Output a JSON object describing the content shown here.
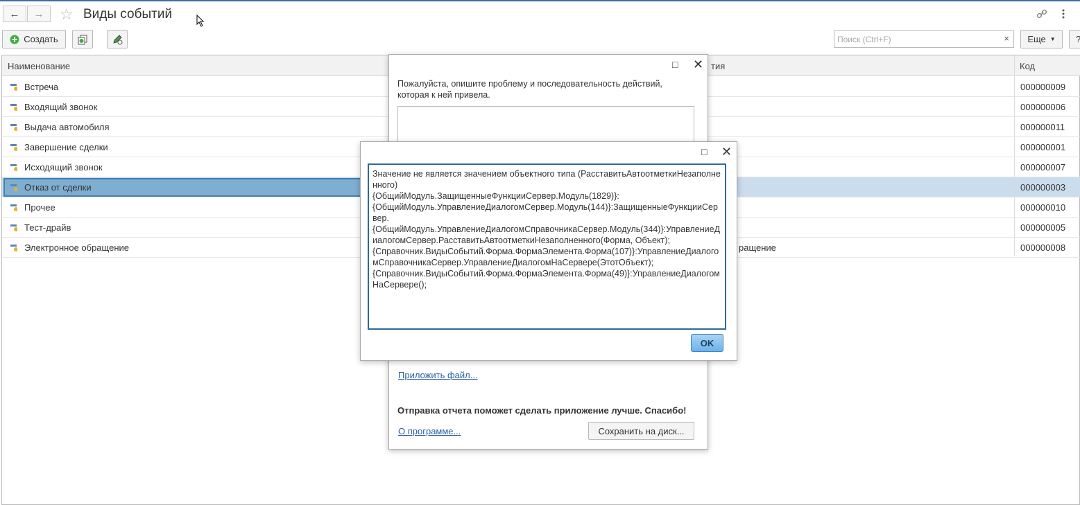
{
  "header": {
    "title": "Виды событий",
    "back_icon": "←",
    "forward_icon": "→",
    "star_icon": "☆"
  },
  "toolbar": {
    "create_label": "Создать",
    "search_placeholder": "Поиск (Ctrl+F)",
    "search_clear": "×",
    "more_label": "Еще",
    "help_label": "?"
  },
  "table": {
    "columns": {
      "name": "Наименование",
      "event_partial": "тия",
      "code": "Код"
    },
    "rows": [
      {
        "name": "Встреча",
        "extra": "",
        "code": "000000009"
      },
      {
        "name": "Входящий звонок",
        "extra": "",
        "code": "000000006"
      },
      {
        "name": "Выдача автомобиля",
        "extra": "",
        "code": "000000011"
      },
      {
        "name": "Завершение сделки",
        "extra": "",
        "code": "000000001"
      },
      {
        "name": "Исходящий звонок",
        "extra": "",
        "code": "000000007"
      },
      {
        "name": "Отказ от сделки",
        "extra": "",
        "code": "000000003"
      },
      {
        "name": "Прочее",
        "extra": "",
        "code": "000000010"
      },
      {
        "name": "Тест-драйв",
        "extra": "",
        "code": "000000005"
      },
      {
        "name": "Электронное обращение",
        "extra": "ращение",
        "code": "000000008"
      }
    ],
    "selected_index": 5
  },
  "report_dialog": {
    "prompt": "Пожалуйста, опишите проблему и последовательность действий, которая к ней привела.",
    "attach_link": "Приложить файл...",
    "thanks": "Отправка отчета поможет сделать приложение лучше. Спасибо!",
    "about_link": "О программе...",
    "save_button": "Сохранить на диск..."
  },
  "error_dialog": {
    "message": "Значение не является значением объектного типа (РасставитьАвтоотметкиНезаполненного)\n{ОбщийМодуль.ЗащищенныеФункцииСервер.Модуль(1829)}:\n{ОбщийМодуль.УправлениеДиалогомСервер.Модуль(144)}:ЗащищенныеФункцииСервер.\n{ОбщийМодуль.УправлениеДиалогомСправочникаСервер.Модуль(344)}:УправлениеДиалогомСервер.РасставитьАвтоотметкиНезаполненного(Форма, Объект);\n{Справочник.ВидыСобытий.Форма.ФормаЭлемента.Форма(107)}:УправлениеДиалогомСправочникаСервер.УправлениеДиалогомНаСервере(ЭтотОбъект);\n{Справочник.ВидыСобытий.Форма.ФормаЭлемента.Форма(49)}:УправлениеДиалогомНаСервере();",
    "ok_label": "OK"
  },
  "colors": {
    "accent": "#3a6fa5",
    "selection": "#cbdcec",
    "selection_cell": "#7faed0"
  }
}
